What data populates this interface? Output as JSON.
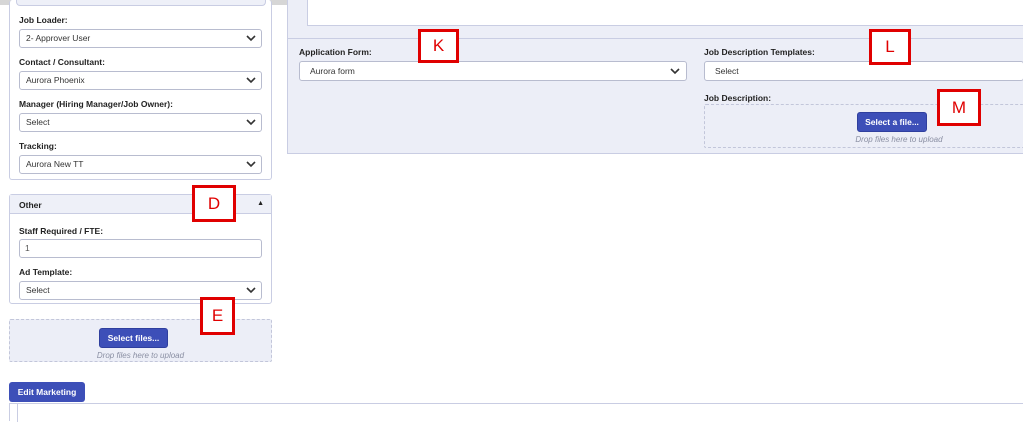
{
  "left": {
    "job_loader": {
      "label": "Job Loader:",
      "value": "2- Approver User"
    },
    "contact": {
      "label": "Contact / Consultant:",
      "value": "Aurora Phoenix"
    },
    "manager": {
      "label": "Manager (Hiring Manager/Job Owner):",
      "value": "Select"
    },
    "tracking": {
      "label": "Tracking:",
      "value": "Aurora New TT"
    },
    "other": {
      "title": "Other",
      "staff": {
        "label": "Staff Required / FTE:",
        "value": "1"
      },
      "ad_template": {
        "label": "Ad Template:",
        "value": "Select"
      }
    },
    "upload": {
      "button": "Select files...",
      "hint": "Drop files here to upload"
    },
    "edit_marketing": "Edit Marketing"
  },
  "right": {
    "application_form": {
      "label": "Application Form:",
      "value": "Aurora form"
    },
    "jd_templates": {
      "label": "Job Description Templates:",
      "value": "Select"
    },
    "job_description": {
      "label": "Job Description:",
      "button": "Select a file...",
      "hint": "Drop files here to upload"
    }
  },
  "annotations": {
    "d": "D",
    "e": "E",
    "k": "K",
    "l": "L",
    "m": "M"
  },
  "colors": {
    "accent": "#3d4fb8",
    "annotation": "#e00000",
    "panel": "#eceef7"
  }
}
